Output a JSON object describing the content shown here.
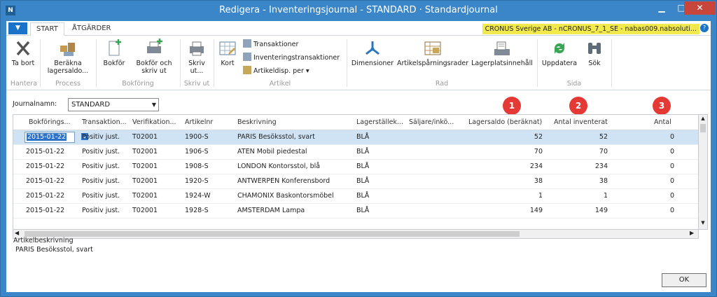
{
  "window": {
    "title": "Redigera - Inventeringsjournal - STANDARD · Standardjournal",
    "min": "▁",
    "max": "□",
    "close": "✕"
  },
  "tabs": [
    {
      "label": "START"
    },
    {
      "label": "ÅTGÄRDER"
    }
  ],
  "company": "CRONUS Sverige AB - nCRONUS_7_1_SE - nabas009.nabsoluti...",
  "ribbon": {
    "ta_bort": "Ta bort",
    "berakna": "Beräkna lagersaldo...",
    "bokfor": "Bokför",
    "bokfor_skriv": "Bokför och skriv ut",
    "skriv_ut": "Skriv ut...",
    "kort": "Kort",
    "transaktioner": "Transaktioner",
    "inv_transaktioner": "Inventeringstransaktioner",
    "artikeldisp": "Artikeldisp. per",
    "dimensioner": "Dimensioner",
    "artikelsparning": "Artikelspårningsrader",
    "lagerplats": "Lagerplatsinnehåll",
    "uppdatera": "Uppdatera",
    "sok": "Sök",
    "groups": {
      "hantera": "Hantera",
      "process": "Process",
      "bokforing": "Bokföring",
      "skriv_ut": "Skriv ut",
      "artikel": "Artikel",
      "rad": "Rad",
      "sida": "Sida"
    }
  },
  "filter": {
    "label": "Journalnamn:",
    "value": "STANDARD"
  },
  "columns": {
    "bokf": "Bokförings...",
    "trans": "Transaktion...",
    "verif": "Verifikation...",
    "artnr": "Artikelnr",
    "beskr": "Beskrivning",
    "lagst": "Lagerställek...",
    "salj": "Säljare/inkö...",
    "saldo": "Lagersaldo (beräknat)",
    "antal_inv": "Antal inventerat",
    "antal": "Antal"
  },
  "rows": [
    {
      "date": "2015-01-22",
      "type": "Positiv just.",
      "verif": "T02001",
      "item": "1900-S",
      "desc": "PARIS Besöksstol, svart",
      "loc": "BLÅ",
      "calc": "52",
      "inv": "52",
      "qty": "0"
    },
    {
      "date": "2015-01-22",
      "type": "Positiv just.",
      "verif": "T02001",
      "item": "1906-S",
      "desc": "ATEN Mobil piedestal",
      "loc": "BLÅ",
      "calc": "70",
      "inv": "70",
      "qty": "0"
    },
    {
      "date": "2015-01-22",
      "type": "Positiv just.",
      "verif": "T02001",
      "item": "1908-S",
      "desc": "LONDON Kontorsstol, blå",
      "loc": "BLÅ",
      "calc": "234",
      "inv": "234",
      "qty": "0"
    },
    {
      "date": "2015-01-22",
      "type": "Positiv just.",
      "verif": "T02001",
      "item": "1920-S",
      "desc": "ANTWERPEN Konferensbord",
      "loc": "BLÅ",
      "calc": "38",
      "inv": "38",
      "qty": "0"
    },
    {
      "date": "2015-01-22",
      "type": "Positiv just.",
      "verif": "T02001",
      "item": "1924-W",
      "desc": "CHAMONIX Baskontorsmöbel",
      "loc": "BLÅ",
      "calc": "1",
      "inv": "1",
      "qty": "0"
    },
    {
      "date": "2015-01-22",
      "type": "Positiv just.",
      "verif": "T02001",
      "item": "1928-S",
      "desc": "AMSTERDAM Lampa",
      "loc": "BLÅ",
      "calc": "149",
      "inv": "149",
      "qty": "0"
    }
  ],
  "badges": [
    "1",
    "2",
    "3"
  ],
  "info": {
    "label": "Artikelbeskrivning",
    "value": "PARIS Besöksstol, svart"
  },
  "ok": "OK"
}
